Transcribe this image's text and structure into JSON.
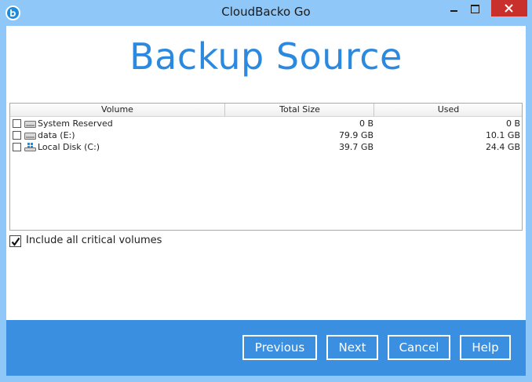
{
  "window": {
    "title": "CloudBacko Go"
  },
  "page": {
    "heading": "Backup Source"
  },
  "table": {
    "columns": {
      "volume": "Volume",
      "total_size": "Total Size",
      "used": "Used"
    },
    "rows": [
      {
        "name": "System Reserved",
        "total_size": "0 B",
        "used": "0 B",
        "icon": "drive-icon",
        "checked": false
      },
      {
        "name": "data (E:)",
        "total_size": "79.9 GB",
        "used": "10.1 GB",
        "icon": "drive-icon",
        "checked": false
      },
      {
        "name": "Local Disk (C:)",
        "total_size": "39.7 GB",
        "used": "24.4 GB",
        "icon": "system-drive-icon",
        "checked": false
      }
    ]
  },
  "options": {
    "include_critical_label": "Include all critical volumes",
    "include_critical_checked": true
  },
  "footer": {
    "previous": "Previous",
    "next": "Next",
    "cancel": "Cancel",
    "help": "Help"
  },
  "colors": {
    "titlebar": "#8fc8f8",
    "heading": "#2b8ae0",
    "footer": "#3a8fe0",
    "close": "#c9302c"
  }
}
